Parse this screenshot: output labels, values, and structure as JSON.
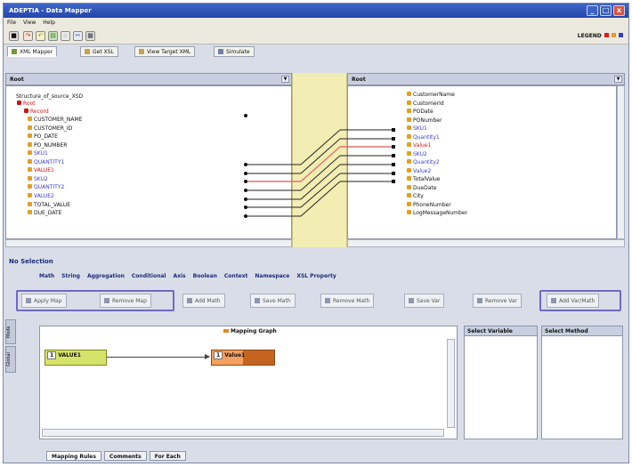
{
  "window": {
    "title": "ADEPTIA - Data Mapper",
    "buttons": [
      "_",
      "□",
      "x"
    ]
  },
  "menu": [
    "File",
    "View",
    "Help"
  ],
  "toolbar": {
    "icons": [
      "save-icon",
      "redo-icon",
      "undo-icon",
      "green-icon",
      "blank-icon",
      "cut-icon",
      "grid-icon"
    ],
    "legend_label": "LEGEND",
    "legend_colors": [
      "#e21b1b",
      "#e2a020",
      "#3b3bc9"
    ]
  },
  "view_tabs": [
    "XML Mapper",
    "Get XSL",
    "View Target XML",
    "Simulate"
  ],
  "source": {
    "header": "Root",
    "nodes": [
      {
        "label": "Structure_of_source_XSD",
        "color": "black"
      },
      {
        "label": "Root",
        "color": "red"
      },
      {
        "label": "Record",
        "color": "red"
      },
      {
        "label": "CUSTOMER_NAME",
        "color": "black"
      },
      {
        "label": "CUSTOMER_ID",
        "color": "black"
      },
      {
        "label": "PO_DATE",
        "color": "black"
      },
      {
        "label": "PO_NUMBER",
        "color": "black"
      },
      {
        "label": "SKU1",
        "color": "blue"
      },
      {
        "label": "QUANTITY1",
        "color": "blue"
      },
      {
        "label": "VALUE1",
        "color": "red"
      },
      {
        "label": "SKU2",
        "color": "blue"
      },
      {
        "label": "QUANTITY2",
        "color": "blue"
      },
      {
        "label": "VALUE2",
        "color": "blue"
      },
      {
        "label": "TOTAL_VALUE",
        "color": "black"
      },
      {
        "label": "DUE_DATE",
        "color": "black"
      }
    ]
  },
  "target": {
    "header": "Root",
    "nodes": [
      {
        "label": "CustomerName",
        "color": "black"
      },
      {
        "label": "CustomerId",
        "color": "black"
      },
      {
        "label": "PODate",
        "color": "black"
      },
      {
        "label": "PONumber",
        "color": "black"
      },
      {
        "label": "SKU1",
        "color": "blue"
      },
      {
        "label": "Quantity1",
        "color": "blue"
      },
      {
        "label": "Value1",
        "color": "red"
      },
      {
        "label": "SKU2",
        "color": "blue"
      },
      {
        "label": "Quantity2",
        "color": "blue"
      },
      {
        "label": "Value2",
        "color": "blue"
      },
      {
        "label": "TotalValue",
        "color": "black"
      },
      {
        "label": "DueDate",
        "color": "black"
      },
      {
        "label": "City",
        "color": "black"
      },
      {
        "label": "PhoneNumber",
        "color": "black"
      },
      {
        "label": "LogMessageNumber",
        "color": "black"
      }
    ]
  },
  "selection_title": "No Selection",
  "function_tabs": [
    "Math",
    "String",
    "Aggregation",
    "Conditional",
    "Axis",
    "Boolean",
    "Context",
    "Namespace",
    "XSL Property"
  ],
  "actions": [
    "Apply Map",
    "Remove Map",
    "Add Math",
    "Save Math",
    "Remove Math",
    "Save Var",
    "Remove Var",
    "Add Var/Math"
  ],
  "side_tabs": [
    "Mode",
    "Global"
  ],
  "graph": {
    "title": "Mapping Graph",
    "source_node": {
      "index": "1",
      "label": "VALUE1"
    },
    "target_node": {
      "index": "1",
      "label": "Value1"
    }
  },
  "select_variable_label": "Select Variable",
  "select_method_label": "Select Method",
  "bottom_tabs": [
    "Mapping Rules",
    "Comments",
    "For Each"
  ]
}
